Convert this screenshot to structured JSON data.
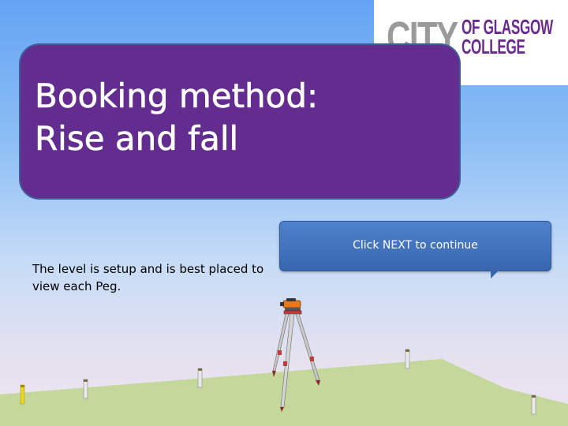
{
  "slide": {
    "title_line1": "Booking method:",
    "title_line2": "Rise and fall",
    "body_text": "The level is setup and is best placed to view each Peg.",
    "callout_label": "Click NEXT to continue"
  },
  "logo": {
    "city": "CITY",
    "sub_line1": "OF GLASGOW",
    "sub_line2": "COLLEGE"
  },
  "colors": {
    "title_panel": "#632c8f",
    "callout": "#3f71bd",
    "ground": "#c5d89b",
    "logo_grey": "#9a9a9c",
    "logo_purple": "#6a2a8f",
    "peg_highlight": "#e7d52a"
  },
  "scene": {
    "pegs": [
      "peg-1",
      "peg-2",
      "peg-3",
      "peg-4",
      "peg-5"
    ],
    "instrument": "level-on-tripod-icon"
  }
}
